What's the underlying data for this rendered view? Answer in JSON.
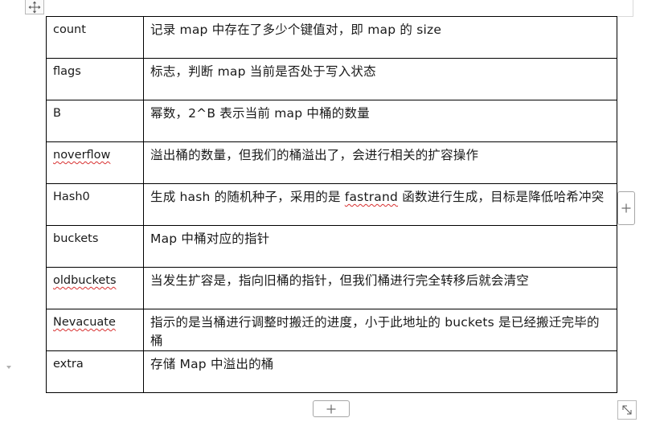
{
  "table": {
    "rows": [
      {
        "field": "count",
        "field_spellcheck": false,
        "desc": "记录 map 中存在了多少个键值对，即 map 的 size"
      },
      {
        "field": "flags",
        "field_spellcheck": false,
        "desc": "标志，判断 map 当前是否处于写入状态"
      },
      {
        "field": "B",
        "field_spellcheck": false,
        "desc": "幂数，2^B 表示当前 map 中桶的数量"
      },
      {
        "field": "noverflow",
        "field_spellcheck": true,
        "desc": "溢出桶的数量，但我们的桶溢出了，会进行相关的扩容操作"
      },
      {
        "field": "Hash0",
        "field_spellcheck": false,
        "desc_before": "生成 hash 的随机种子，采用的是 ",
        "desc_spell": "fastrand",
        "desc_after": " 函数进行生成，目标是降低哈希冲突"
      },
      {
        "field": "buckets",
        "field_spellcheck": false,
        "desc": "Map 中桶对应的指针"
      },
      {
        "field": "oldbuckets",
        "field_spellcheck": true,
        "desc": "当发生扩容是，指向旧桶的指针，但我们桶进行完全转移后就会清空"
      },
      {
        "field": "Nevacuate",
        "field_spellcheck": true,
        "desc": "指示的是当桶进行调整时搬迁的进度，小于此地址的 buckets 是已经搬迁完毕的桶"
      },
      {
        "field": "extra",
        "field_spellcheck": false,
        "desc": "存储 Map 中溢出的桶"
      }
    ]
  },
  "icons": {
    "move_handle": "move-arrows-icon",
    "add_row": "plus-icon",
    "add_column": "plus-icon",
    "resize": "diagonal-resize-icon",
    "margin_caret": "caret-down-icon"
  },
  "colors": {
    "border": "#000000",
    "spellcheck": "#d83030",
    "control_border": "#a6a6a6"
  }
}
